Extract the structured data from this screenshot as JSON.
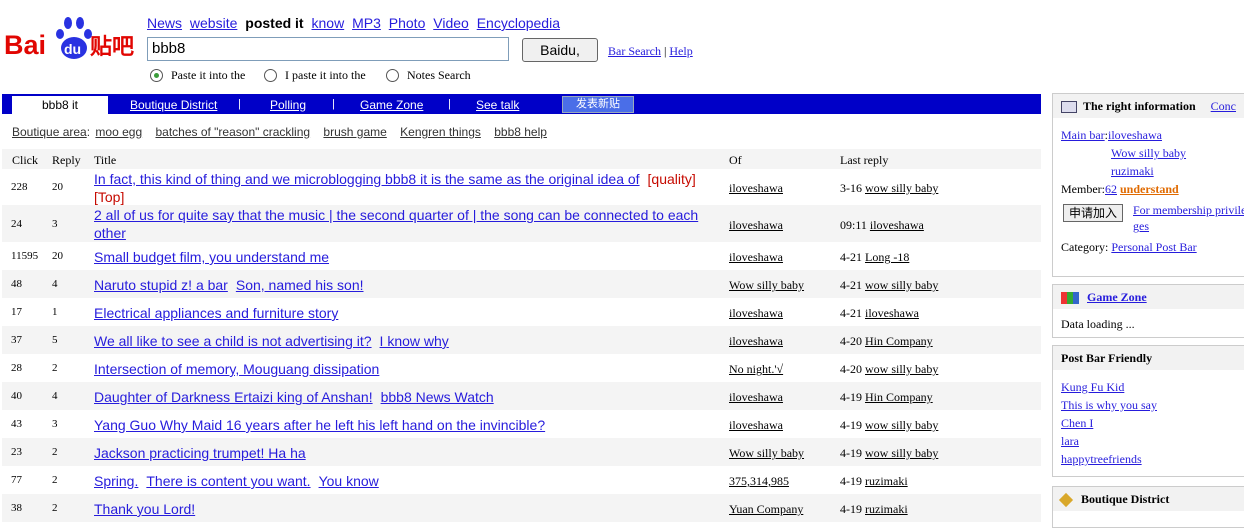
{
  "logo": {
    "text": "Bai",
    "text2": "du",
    "text3": "贴吧"
  },
  "header": {
    "nav": [
      "News",
      "website",
      "posted it",
      "know",
      "MP3",
      "Photo",
      "Video",
      "Encyclopedia"
    ],
    "search_value": "bbb8",
    "search_button": "Baidu,",
    "bar_search": "Bar Search",
    "sep": "|",
    "help": "Help",
    "radio_options": [
      "Paste it into the",
      "I paste it into the",
      "Notes Search"
    ]
  },
  "tabs": {
    "active": "bbb8 it",
    "items": [
      "Boutique District",
      "Polling",
      "Game Zone",
      "See talk"
    ],
    "separator": "|",
    "post_button": "发表新贴"
  },
  "subnav": {
    "prefix": "Boutique area",
    "colon": ":",
    "items": [
      "moo egg",
      "batches of \"reason\" crackling",
      "brush game",
      "Kengren things",
      "bbb8 help"
    ]
  },
  "table": {
    "headers": {
      "click": "Click",
      "reply": "Reply",
      "title": "Title",
      "of": "Of",
      "last": "Last reply"
    },
    "rows": [
      {
        "click": "228",
        "reply": "20",
        "title": [
          "In fact, this kind of thing and we microblogging bbb8 it is the same as the original idea of"
        ],
        "tag": "[quality] [Top]",
        "of": "iloveshawa",
        "time": "3-16",
        "last": "wow silly baby"
      },
      {
        "click": "24",
        "reply": "3",
        "title": [
          "2 all of us for quite say that the music | the second quarter of | the song can be connected to each other"
        ],
        "tag": "",
        "of": "iloveshawa",
        "time": "09:11",
        "last": "iloveshawa"
      },
      {
        "click": "11595",
        "reply": "20",
        "title": [
          "Small budget film, you understand me"
        ],
        "tag": "",
        "of": "iloveshawa",
        "time": "4-21",
        "last": "Long -18"
      },
      {
        "click": "48",
        "reply": "4",
        "title": [
          "Naruto stupid z! a bar",
          "Son, named his son!"
        ],
        "tag": "",
        "of": "Wow silly baby",
        "time": "4-21",
        "last": "wow silly baby"
      },
      {
        "click": "17",
        "reply": "1",
        "title": [
          "Electrical appliances and furniture story"
        ],
        "tag": "",
        "of": "iloveshawa",
        "time": "4-21",
        "last": "iloveshawa"
      },
      {
        "click": "37",
        "reply": "5",
        "title": [
          "We all like to see a child is not advertising it?",
          "I know why"
        ],
        "tag": "",
        "of": "iloveshawa",
        "time": "4-20",
        "last": "Hin Company"
      },
      {
        "click": "28",
        "reply": "2",
        "title": [
          "Intersection of memory, Mouguang dissipation"
        ],
        "tag": "",
        "of": "No night.'√",
        "time": "4-20",
        "last": "wow silly baby"
      },
      {
        "click": "40",
        "reply": "4",
        "title": [
          "Daughter of Darkness Ertaizi king of Anshan!",
          "bbb8 News Watch"
        ],
        "tag": "",
        "of": "iloveshawa",
        "time": "4-19",
        "last": "Hin Company"
      },
      {
        "click": "43",
        "reply": "3",
        "title": [
          "Yang Guo Why Maid 16 years after he left his left hand on the invincible?"
        ],
        "tag": "",
        "of": "iloveshawa",
        "time": "4-19",
        "last": "wow silly baby"
      },
      {
        "click": "23",
        "reply": "2",
        "title": [
          "Jackson practicing trumpet! Ha ha"
        ],
        "tag": "",
        "of": "Wow silly baby",
        "time": "4-19",
        "last": "wow silly baby"
      },
      {
        "click": "77",
        "reply": "2",
        "title": [
          "Spring.",
          "There is content you want.",
          "You know"
        ],
        "tag": "",
        "of": "375,314,985",
        "time": "4-19",
        "last": "ruzimaki"
      },
      {
        "click": "38",
        "reply": "2",
        "title": [
          "Thank you Lord!"
        ],
        "tag": "",
        "of": "Yuan Company",
        "time": "4-19",
        "last": "ruzimaki"
      }
    ]
  },
  "right": {
    "info": {
      "title": "The right information",
      "more": "Conc",
      "main_bar_label": "Main bar",
      "main_bar_colon": ":",
      "managers": [
        "iloveshawa",
        "Wow silly baby",
        "ruzimaki"
      ],
      "member_label": "Member:",
      "member_count": "62",
      "member_link": "understand",
      "apply_button": "申请加入",
      "privilege_link": "For membership privileges",
      "category_label": "Category:",
      "category_value": "Personal Post Bar"
    },
    "game": {
      "title": "Game Zone",
      "body": "Data loading ..."
    },
    "friendly": {
      "title": "Post Bar Friendly",
      "links": [
        "Kung Fu Kid",
        "This is why you say",
        "Chen I",
        "lara",
        "happytreefriends"
      ]
    },
    "boutique": {
      "title": "Boutique District"
    }
  },
  "colors": {
    "accent": "#0000c8",
    "link": "#261cdc",
    "logo_red": "#e10602",
    "logo_blue": "#2932e1",
    "tag_red": "#c60a00"
  }
}
